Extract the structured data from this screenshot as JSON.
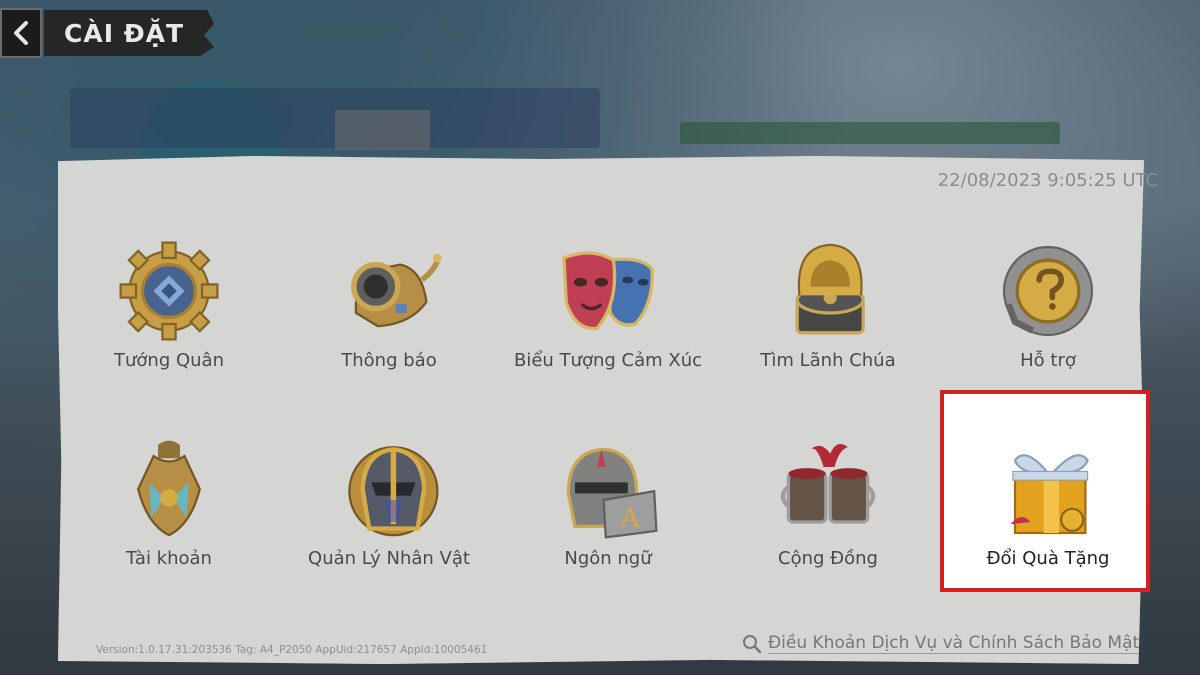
{
  "header": {
    "title": "CÀI ĐẶT",
    "back_icon": "back-arrow-icon"
  },
  "timestamp": "22/08/2023 9:05:25 UTC",
  "tiles": [
    {
      "label": "Tướng Quân",
      "icon": "commander-gear-icon"
    },
    {
      "label": "Thông báo",
      "icon": "horn-icon"
    },
    {
      "label": "Biểu Tượng Cảm Xúc",
      "icon": "masks-icon"
    },
    {
      "label": "Tìm Lãnh Chúa",
      "icon": "compass-icon"
    },
    {
      "label": "Hỗ trợ",
      "icon": "support-icon"
    },
    {
      "label": "Tài khoản",
      "icon": "account-icon"
    },
    {
      "label": "Quản Lý Nhân Vật",
      "icon": "helmet-icon"
    },
    {
      "label": "Ngôn ngữ",
      "icon": "language-icon"
    },
    {
      "label": "Cộng Đồng",
      "icon": "community-mugs-icon"
    },
    {
      "label": "Đổi Quà Tặng",
      "icon": "gift-box-icon"
    }
  ],
  "footer": {
    "version": "Version:1.0.17.31:203536 Tag: A4_P2050 AppUid:217657 AppId:10005461",
    "terms_link": "Điều Khoản Dịch Vụ và Chính Sách Bảo Mật"
  },
  "colors": {
    "highlight_border": "#d62020",
    "panel": "#e3e3e1",
    "gold": "#d4a838"
  }
}
